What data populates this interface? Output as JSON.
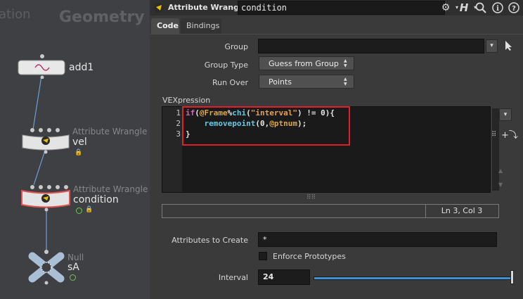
{
  "network": {
    "title_partial": "ation",
    "title": "Geometry",
    "nodes": [
      {
        "name": "add1",
        "type": ""
      },
      {
        "name": "vel",
        "type": "Attribute Wrangle"
      },
      {
        "name": "condition",
        "type": "Attribute Wrangle"
      },
      {
        "name": "sA",
        "type": "Null"
      }
    ]
  },
  "toolbar": {
    "op_type": "Attribute Wrangle",
    "node_name": "condition",
    "icons": [
      "gear-icon",
      "help-h-icon",
      "search-icon",
      "info-icon",
      "help-icon"
    ]
  },
  "tabs": [
    {
      "label": "Code",
      "active": true
    },
    {
      "label": "Bindings",
      "active": false
    }
  ],
  "params": {
    "group_label": "Group",
    "group_value": "",
    "group_type_label": "Group Type",
    "group_type_value": "Guess from Group",
    "run_over_label": "Run Over",
    "run_over_value": "Points",
    "vex_label": "VEXpression",
    "code_lines": [
      "if(@Frame%chi(\"interval\") != 0){",
      "    removepoint(0,@ptnum);",
      "}"
    ],
    "line_numbers": [
      "1",
      "2",
      "3"
    ],
    "cursor_status": "Ln 3, Col 3",
    "attributes_label": "Attributes to Create",
    "attributes_value": "*",
    "enforce_label": "Enforce Prototypes",
    "enforce_checked": false,
    "interval_label": "Interval",
    "interval_value": "24"
  },
  "colors": {
    "highlight_box": "#e0202a",
    "slider_fill": "#3d8fd6",
    "display_flag": "#66cc44"
  }
}
